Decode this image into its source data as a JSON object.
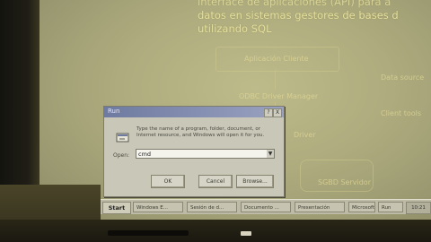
{
  "slide": {
    "lines": [
      "interface de aplicaciones (API) para a",
      "datos en sistemas gestores de bases d",
      "utilizando SQL"
    ],
    "diagram_labels": [
      "Aplicación Cliente",
      "ODBC Driver Manager",
      "Driver",
      "SGBD Servidor",
      "Data source",
      "Client tools"
    ]
  },
  "run_dialog": {
    "title": "Run",
    "help_label": "?",
    "close_label": "X",
    "icon": "run-program-icon",
    "description": "Type the name of a program, folder, document, or Internet resource, and Windows will open it for you.",
    "open_label": "Open:",
    "open_value": "cmd",
    "buttons": {
      "ok": "OK",
      "cancel": "Cancel",
      "browse": "Browse..."
    }
  },
  "taskbar": {
    "start_label": "Start",
    "items": [
      "Windows E...",
      "Sesión de d...",
      "Documento ...",
      "Presentación",
      "Microsoft P...",
      "Run"
    ],
    "clock": "10:21"
  },
  "colors": {
    "screen": "#aeac7e",
    "slide_text": "#e7e1a0",
    "dialog_bg": "#c9c7b8",
    "title_bar": "#6e7aa0"
  }
}
